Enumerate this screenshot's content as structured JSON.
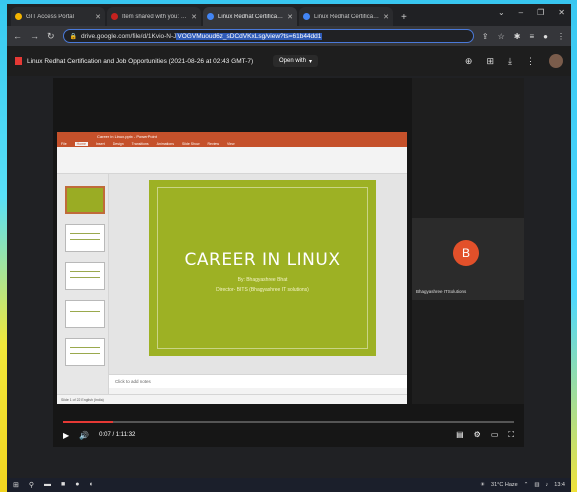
{
  "browser": {
    "tabs": [
      {
        "title": "GIT Access Portal",
        "color": "#f4b400",
        "active": false
      },
      {
        "title": "Item shared with you: \"Linux Red",
        "color": "#c5221f",
        "active": false
      },
      {
        "title": "Linux Redhat Certification and Jo",
        "color": "#4285f4",
        "active": true
      },
      {
        "title": "Linux Redhat Certification and Jo",
        "color": "#4285f4",
        "active": false
      }
    ],
    "url_prefix": "drive.google.com/file/d/1Kvio-N-J",
    "url_selected": "VOGVMuoud6z_sDCdVKxLsg/view?ts=61b44dd1"
  },
  "viewer": {
    "title": "Linux Redhat Certification and Job Opportunities (2021-08-26 at 02:43 GMT-7)",
    "open_with": "Open with"
  },
  "slide": {
    "app_title": "Career in Linux.pptx - PowerPoint",
    "menu": [
      "File",
      "Home",
      "Insert",
      "Design",
      "Transitions",
      "Animations",
      "Slide Show",
      "Review",
      "View"
    ],
    "main_title": "CAREER IN LINUX",
    "byline": "By: Bhagyashree Bhat",
    "director": "Director- BITS (Bhagyashree IT solutions)",
    "notes_placeholder": "Click to add notes",
    "status": "Slide 1 of 22   English (India)",
    "accent": "#9db124"
  },
  "participant": {
    "initial": "B",
    "name": "Bhagyashree ITSolutions"
  },
  "player": {
    "time": "0:07 / 1:11:32",
    "progress": 0.11
  },
  "taskbar": {
    "weather": "31°C Haze",
    "clock": "13:4"
  }
}
